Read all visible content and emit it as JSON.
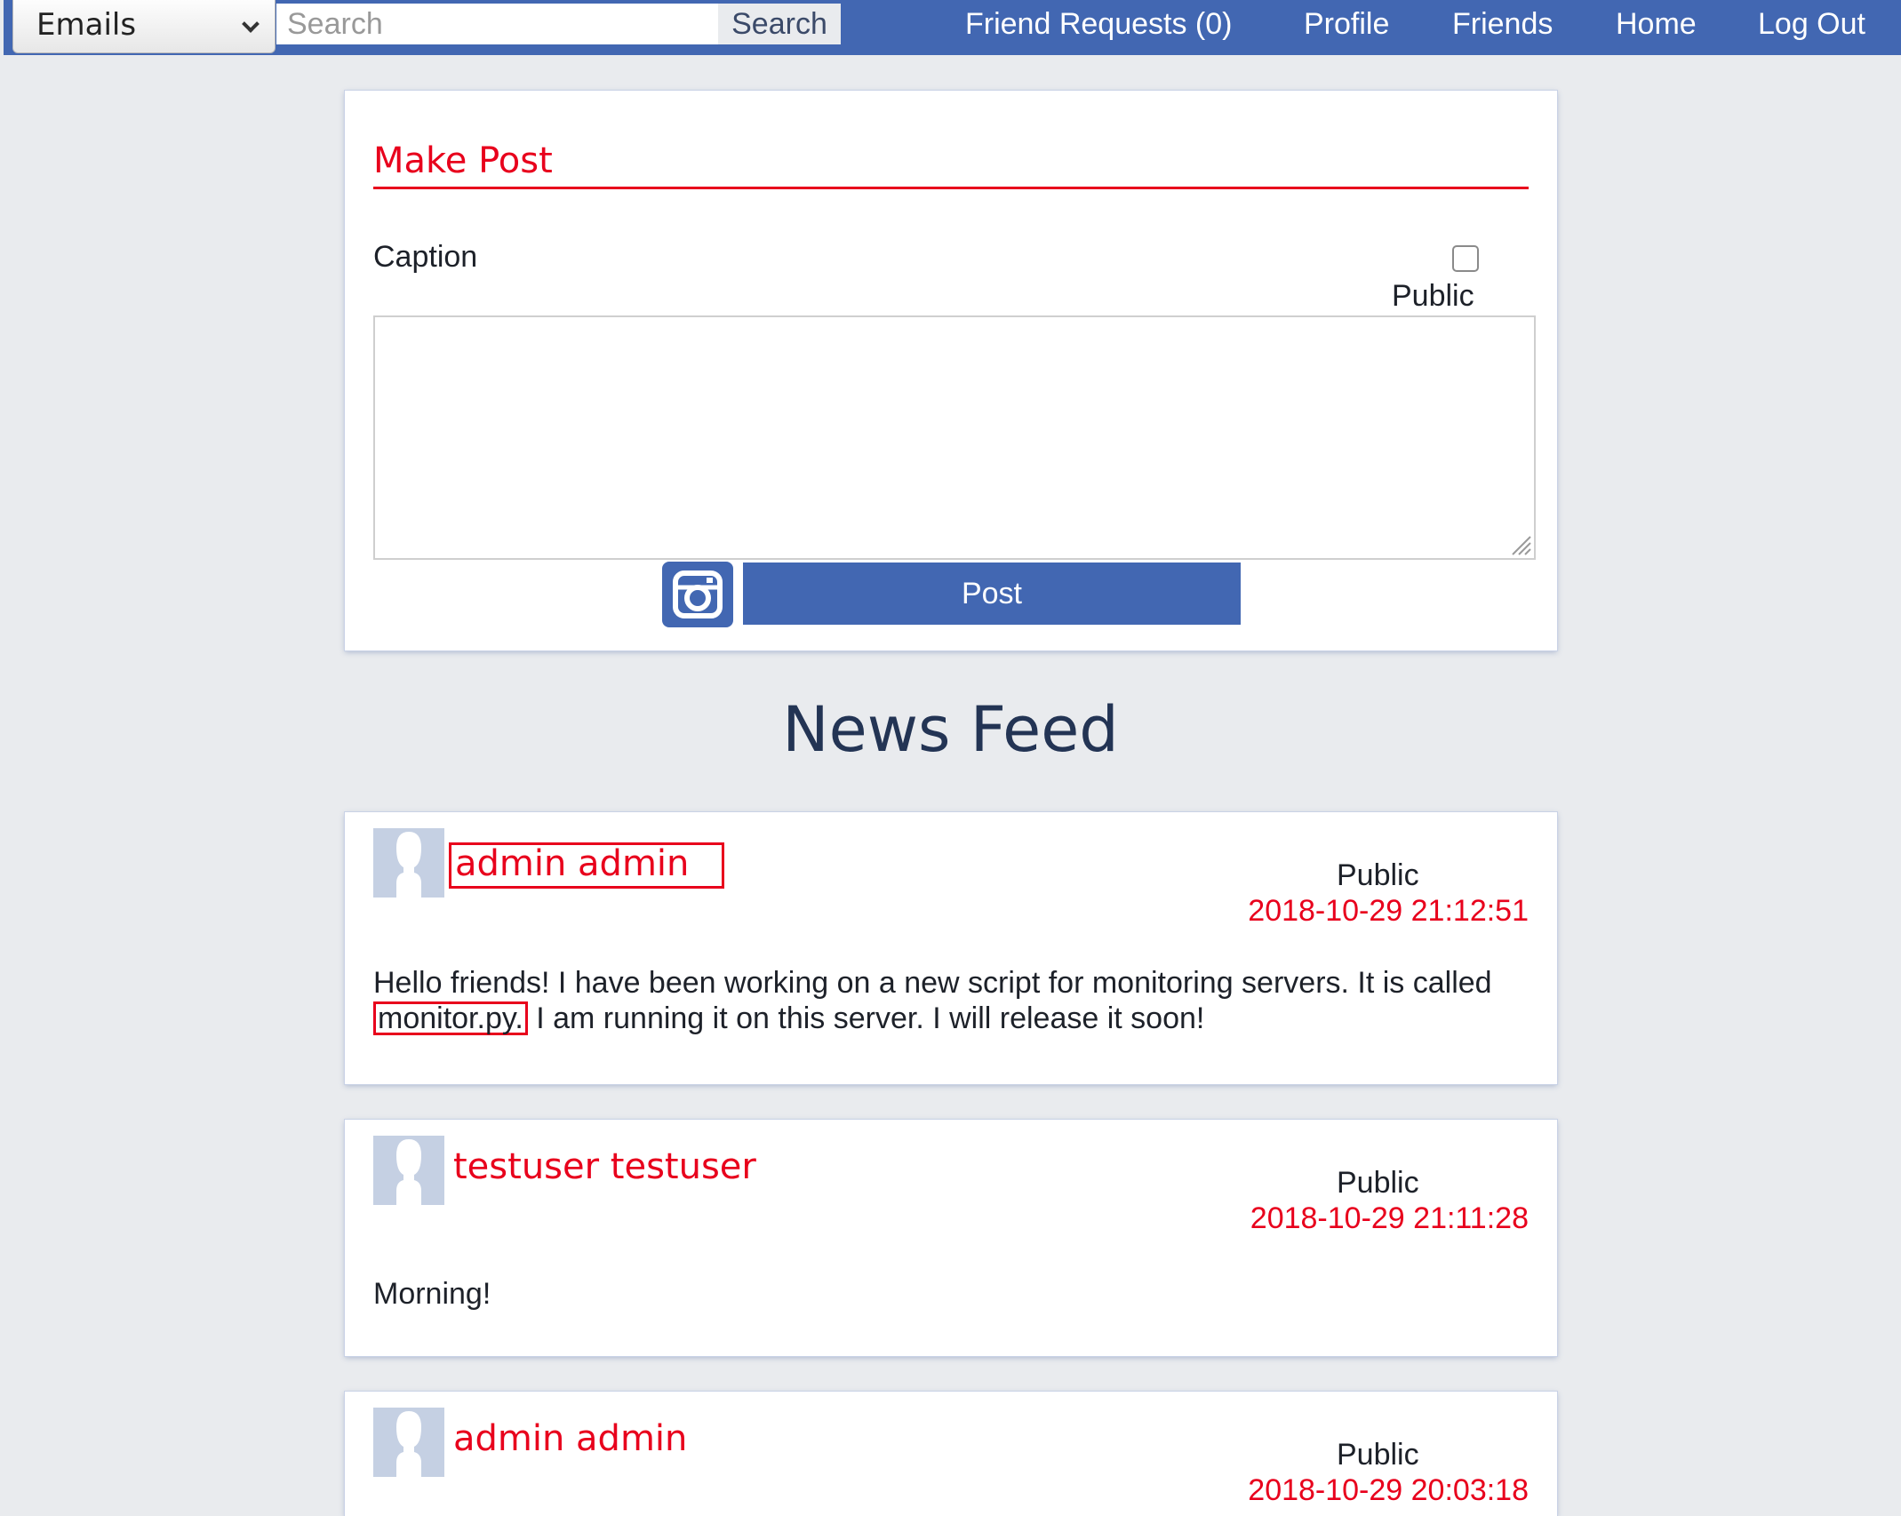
{
  "topbar": {
    "select_value": "Emails",
    "search_placeholder": "Search",
    "search_button": "Search",
    "nav": [
      {
        "label": "Friend Requests (0)"
      },
      {
        "label": "Profile"
      },
      {
        "label": "Friends"
      },
      {
        "label": "Home"
      },
      {
        "label": "Log Out"
      }
    ]
  },
  "composer": {
    "title": "Make Post",
    "caption_label": "Caption",
    "public_label": "Public",
    "public_checked": false,
    "caption_value": "",
    "camera_icon": "camera-icon",
    "post_button": "Post"
  },
  "feed": {
    "title": "News Feed",
    "posts": [
      {
        "author": "admin admin",
        "visibility": "Public",
        "timestamp": "2018-10-29 21:12:51",
        "text_before": "Hello friends! I have been working on a new script for monitoring servers. It is called",
        "text_highlight": "monitor.py.",
        "text_after": " I am running it on this server. I will release it soon!"
      },
      {
        "author": "testuser testuser",
        "visibility": "Public",
        "timestamp": "2018-10-29 21:11:28",
        "text": "Morning!"
      },
      {
        "author": "admin admin",
        "visibility": "Public",
        "timestamp": "2018-10-29 20:03:18"
      }
    ]
  },
  "colors": {
    "brand_blue": "#4267b2",
    "accent_red": "#e8001c",
    "page_bg": "#e9ebee"
  }
}
